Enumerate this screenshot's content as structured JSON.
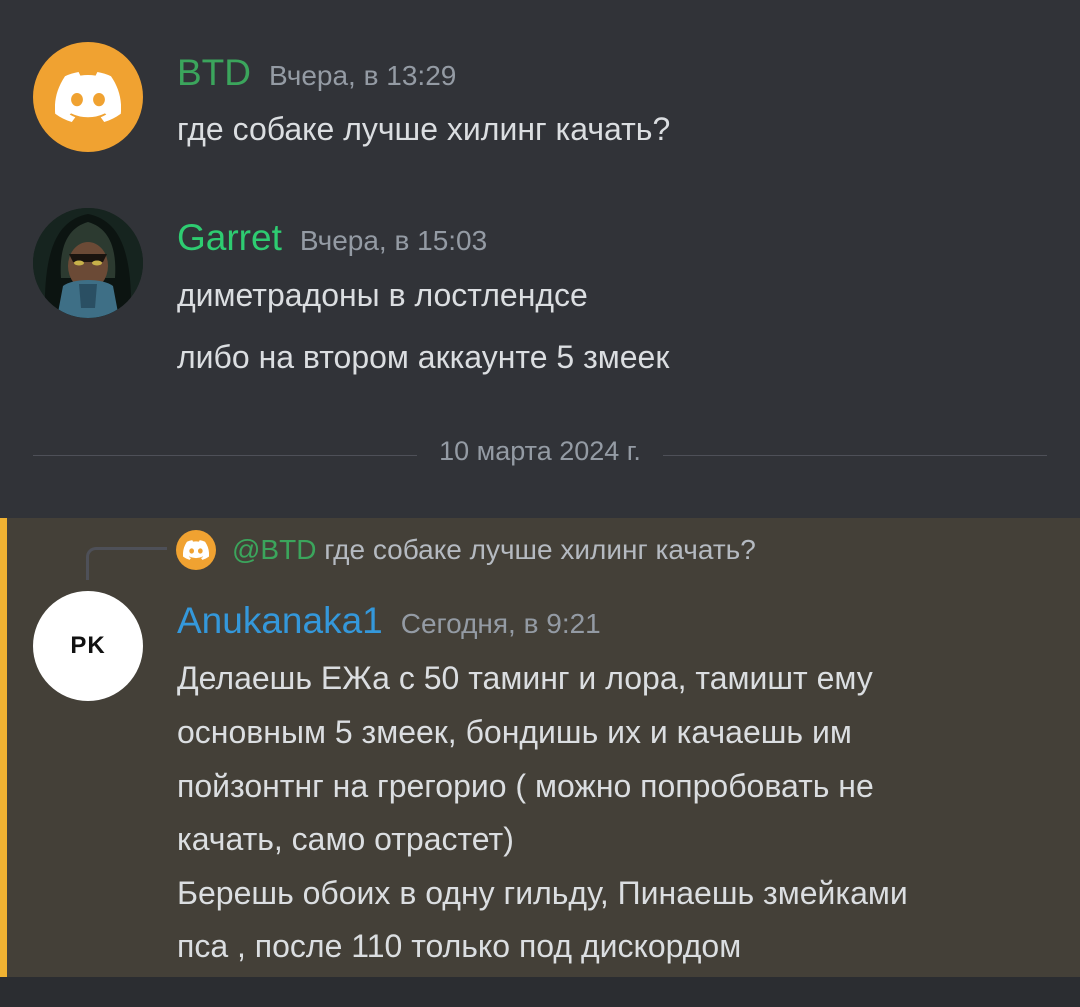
{
  "messages": [
    {
      "username": "BTD",
      "username_color": "#3ba55c",
      "timestamp": "Вчера, в 13:29",
      "avatar_icon": "discord-logo-icon",
      "lines": [
        "где собаке лучше хилинг качать?"
      ]
    },
    {
      "username": "Garret",
      "username_color": "#2ecc71",
      "timestamp": "Вчера, в 15:03",
      "avatar_icon": "hooded-figure-avatar",
      "lines": [
        "диметрадоны в лостлендсе",
        "либо на втором аккаунте 5 змеек"
      ]
    },
    {
      "username": "Anukanaka1",
      "username_color": "#3498db",
      "timestamp": "Сегодня, в 9:21",
      "avatar_text": "PK",
      "reply": {
        "mention": "@BTD",
        "text": "где собаке лучше хилинг качать?"
      },
      "lines": [
        "Делаешь ЕЖа с 50 таминг и лора, тамишт ему",
        "основным 5 змеек, бондишь их и качаешь им",
        "пойзонтнг на грегорио ( можно попробовать не",
        "качать, само отрастет)",
        "Берешь обоих в одну гильду, Пинаешь змейками",
        "пса , после 110 только под дискордом"
      ]
    }
  ],
  "date_divider": "10 марта 2024 г.",
  "colors": {
    "background": "#313338",
    "highlight": "#444038",
    "highlight_bar": "#f0b232"
  }
}
